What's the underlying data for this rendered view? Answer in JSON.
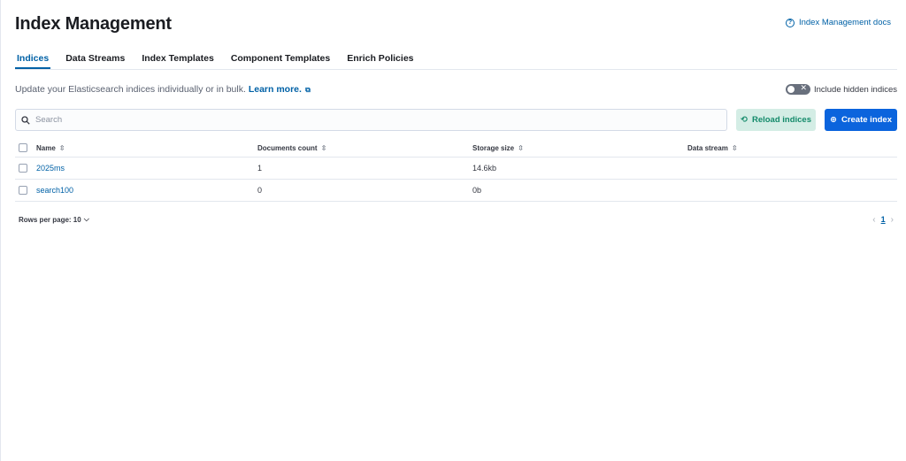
{
  "page": {
    "title": "Index Management",
    "docs_link": "Index Management docs",
    "docs_icon": "question-circle-icon"
  },
  "tabs": [
    {
      "label": "Indices",
      "active": true
    },
    {
      "label": "Data Streams",
      "active": false
    },
    {
      "label": "Index Templates",
      "active": false
    },
    {
      "label": "Component Templates",
      "active": false
    },
    {
      "label": "Enrich Policies",
      "active": false
    }
  ],
  "description": {
    "text": "Update your Elasticsearch indices individually or in bulk.",
    "learn_more": "Learn more."
  },
  "hidden_toggle": {
    "label": "Include hidden indices",
    "checked": false
  },
  "search": {
    "placeholder": "Search",
    "value": ""
  },
  "buttons": {
    "reload": "Reload indices",
    "create": "Create index"
  },
  "table": {
    "columns": [
      "Name",
      "Documents count",
      "Storage size",
      "Data stream"
    ],
    "rows": [
      {
        "name": "2025ms",
        "documents_count": "1",
        "storage_size": "14.6kb",
        "data_stream": ""
      },
      {
        "name": "search100",
        "documents_count": "0",
        "storage_size": "0b",
        "data_stream": ""
      }
    ]
  },
  "pagination": {
    "rows_per_page": "Rows per page: 10",
    "current_page": "1"
  },
  "colors": {
    "primary": "#0b64dd",
    "link": "#0061a6",
    "success_bg": "#d4ede5",
    "success_text": "#138a6a"
  }
}
